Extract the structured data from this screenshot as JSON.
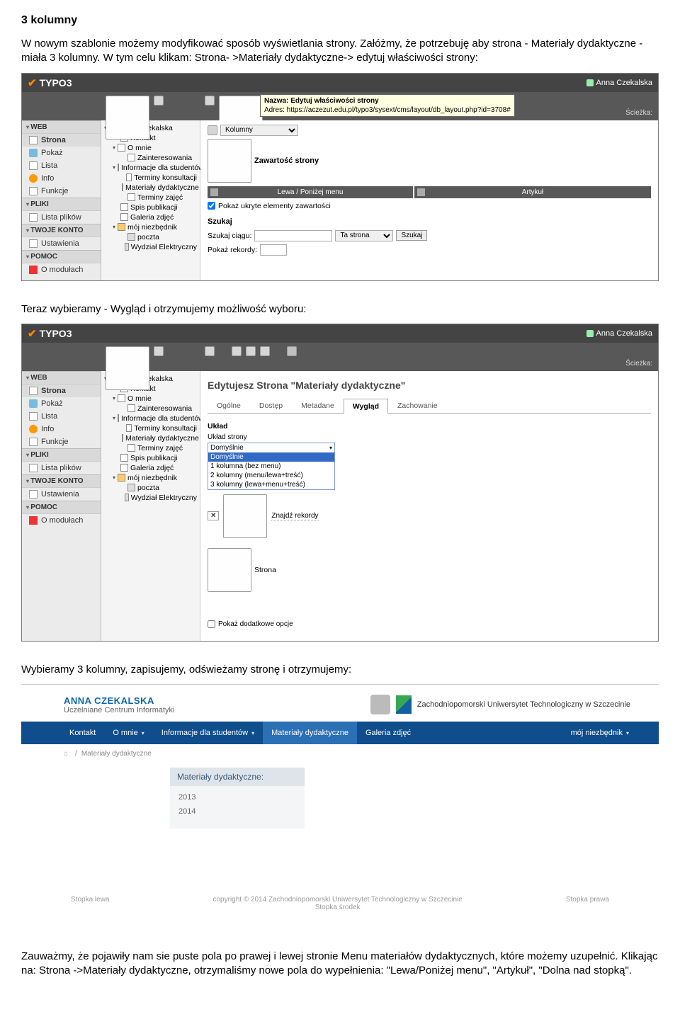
{
  "doc": {
    "heading": "3 kolumny",
    "p1": "W nowym szablonie możemy modyfikować sposób wyświetlania strony. Załóżmy, że potrzebuję aby strona - Materiały dydaktyczne - miała 3 kolumny. W tym celu klikam: Strona- >Materiały dydaktyczne-> edytuj właściwości strony:",
    "p2": "Teraz wybieramy - Wygląd i otrzymujemy możliwość wyboru:",
    "p3": "Wybieramy 3 kolumny, zapisujemy, odświeżamy stronę i otrzymujemy:",
    "p4": "Zauważmy, że pojawiły nam sie puste pola po prawej i lewej stronie Menu materiałów dydaktycznych, które możemy uzupełnić. Klikając na: Strona ->Materiały dydaktyczne, otrzymaliśmy nowe pola do wypełnienia: \"Lewa/Poniżej menu\", \"Artykuł\", \"Dolna nad stopką\"."
  },
  "common": {
    "brand": "TYPO3",
    "user": "Anna Czekalska",
    "path_label": "Ścieżka:",
    "leftnav": {
      "web": {
        "h": "WEB",
        "items": [
          "Strona",
          "Pokaż",
          "Lista",
          "Info",
          "Funkcje"
        ]
      },
      "pliki": {
        "h": "PLIKI",
        "items": [
          "Lista plików"
        ]
      },
      "konto": {
        "h": "TWOJE KONTO",
        "items": [
          "Ustawienia"
        ]
      },
      "pomoc": {
        "h": "POMOC",
        "items": [
          "O modułach"
        ]
      }
    },
    "tree": {
      "root": "Anna Czekalska",
      "items": [
        {
          "l": 1,
          "t": "Kontakt"
        },
        {
          "l": 1,
          "t": "O mnie",
          "caret": true
        },
        {
          "l": 2,
          "t": "Zainteresowania"
        },
        {
          "l": 1,
          "t": "Informacje dla studentów",
          "caret": true
        },
        {
          "l": 2,
          "t": "Terminy konsultacji"
        },
        {
          "l": 2,
          "t": "Materiały dydaktyczne"
        },
        {
          "l": 2,
          "t": "Terminy zajęć"
        },
        {
          "l": 1,
          "t": "Spis publikacji"
        },
        {
          "l": 1,
          "t": "Galeria zdjęć"
        },
        {
          "l": 1,
          "t": "mój niezbędnik",
          "caret": true,
          "folder": true
        },
        {
          "l": 2,
          "t": "poczta",
          "ext": true
        },
        {
          "l": 2,
          "t": "Wydział Elektryczny",
          "ext": true
        }
      ]
    }
  },
  "shot1": {
    "tooltip": {
      "title": "Nazwa: Edytuj właściwości strony",
      "addr": "Adres: https://aczezut.edu.pl/typo3/sysext/cms/layout/db_layout.php?id=3708#"
    },
    "topselect": "Kolumny",
    "content_line": "Zawartość strony",
    "colL": "Lewa / Poniżej menu",
    "colR": "Artykuł",
    "chk": "Pokaż ukryte elementy zawartości",
    "szukaj": {
      "h": "Szukaj",
      "l1": "Szukaj ciągu:",
      "l2": "Pokaż rekordy:",
      "scope": "Ta strona",
      "btn": "Szukaj"
    }
  },
  "shot2": {
    "title": "Edytujesz Strona \"Materiały dydaktyczne\"",
    "tabs": [
      "Ogólne",
      "Dostęp",
      "Metadane",
      "Wygląd",
      "Zachowanie"
    ],
    "active_tab": 3,
    "uklad": "Układ",
    "uklad_strony": "Układ strony",
    "sel_top": "Domyślnie",
    "options": [
      "Domyślnie",
      "1 kolumna (bez menu)",
      "2 kolumny (menu/lewa+treść)",
      "3 kolumny (lewa+menu+treść)"
    ],
    "opt_h": 0,
    "znajdz": "Znajdź rekordy",
    "strona_link": "Strona",
    "chk": "Pokaż dodatkowe opcje"
  },
  "shot3": {
    "name": "ANNA CZEKALSKA",
    "sub": "Uczelniane Centrum Informatyki",
    "uni": "Zachodniopomorski Uniwersytet Technologiczny w Szczecinie",
    "menu": [
      {
        "t": "Kontakt"
      },
      {
        "t": "O mnie",
        "dd": true
      },
      {
        "t": "Informacje dla studentów",
        "dd": true
      },
      {
        "t": "Materiały dydaktyczne",
        "active": true
      },
      {
        "t": "Galeria zdjęć"
      }
    ],
    "menu_right": {
      "t": "mój niezbędnik",
      "dd": true
    },
    "bc": "Materiały dydaktyczne",
    "card_h": "Materiały dydaktyczne:",
    "card_items": [
      "2013",
      "2014"
    ],
    "footer": {
      "l": "Stopka lewa",
      "c1": "copyright © 2014 Zachodniopomorski Uniwersytet Technologiczny w Szczecinie",
      "c2": "Stopka środek",
      "r": "Stopka prawa"
    }
  }
}
